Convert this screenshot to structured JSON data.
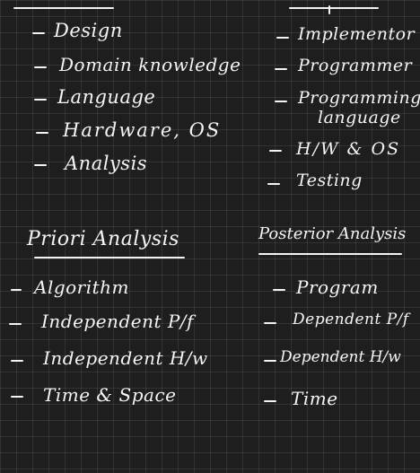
{
  "top_left": {
    "items": [
      "Design",
      "Domain knowledge",
      "Language",
      "Hardware, OS",
      "Analysis"
    ]
  },
  "top_right": {
    "items": [
      "Implementor",
      "Programmer",
      "Programming",
      "language",
      "H/W & OS",
      "Testing"
    ]
  },
  "priori": {
    "title": "Priori Analysis",
    "items": [
      "Algorithm",
      "Independent P/f",
      "Independent H/w",
      "Time & Space"
    ]
  },
  "posterior": {
    "title": "Posterior Analysis",
    "items": [
      "Program",
      "Dependent P/f",
      "Dependent H/w",
      "Time"
    ]
  }
}
